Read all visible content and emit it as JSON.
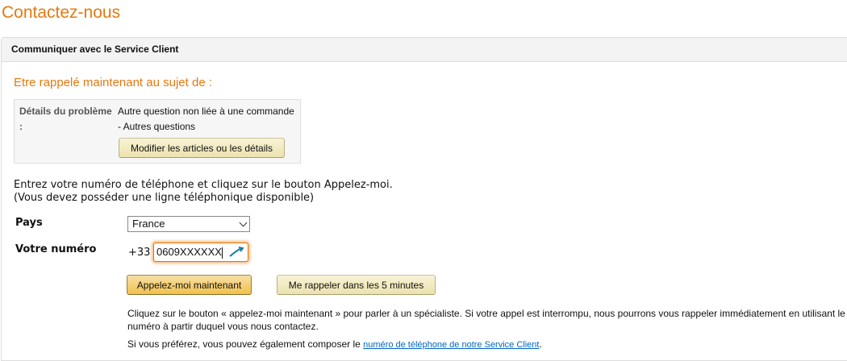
{
  "page": {
    "title": "Contactez-nous"
  },
  "panel": {
    "header": "Communiquer avec le Service Client"
  },
  "callback": {
    "title": "Etre rappelé maintenant au sujet de :",
    "details_label": "Détails du problème :",
    "details_line1": "Autre question non liée à une commande",
    "details_line2": "- Autres questions",
    "modify_button": "Modifier les articles ou les détails"
  },
  "instructions": {
    "line1": "Entrez votre numéro de téléphone et cliquez sur le bouton Appelez-moi.",
    "line2": "(Vous devez posséder une ligne téléphonique disponible)"
  },
  "form": {
    "country_label": "Pays",
    "country_value": "France",
    "phone_label": "Votre numéro",
    "phone_prefix": "+33",
    "phone_value": "0609XXXXXX"
  },
  "actions": {
    "call_now": "Appelez-moi maintenant",
    "call_later": "Me rappeler dans les 5 minutes"
  },
  "notes": {
    "retry": "Cliquez sur le bouton « appelez-moi maintenant » pour parler à un spécialiste. Si votre appel est interrompu, nous pourrons vous rappeler immédiatement en utilisant le numéro à partir duquel vous nous contactez.",
    "alternative_prefix": "Si vous préférez, vous pouvez également composer le ",
    "alternative_link": "numéro de téléphone de notre Service Client",
    "alternative_suffix": "."
  },
  "colors": {
    "accent": "#e47911",
    "link": "#0066c0",
    "primary_button": "#f0c14b"
  },
  "icons": {
    "phone_input": "handset-icon",
    "select": "chevron-down-icon"
  }
}
